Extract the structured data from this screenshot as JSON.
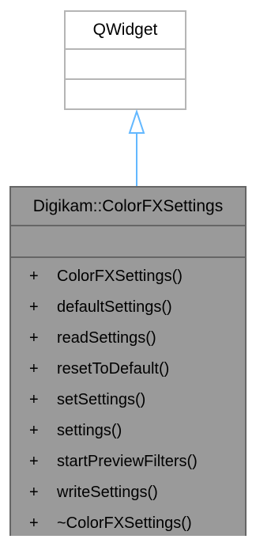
{
  "base_class": {
    "name": "QWidget"
  },
  "derived_class": {
    "name": "Digikam::ColorFXSettings",
    "methods": [
      {
        "visibility": "+",
        "name": "ColorFXSettings()"
      },
      {
        "visibility": "+",
        "name": "defaultSettings()"
      },
      {
        "visibility": "+",
        "name": "readSettings()"
      },
      {
        "visibility": "+",
        "name": "resetToDefault()"
      },
      {
        "visibility": "+",
        "name": "setSettings()"
      },
      {
        "visibility": "+",
        "name": "settings()"
      },
      {
        "visibility": "+",
        "name": "startPreviewFilters()"
      },
      {
        "visibility": "+",
        "name": "writeSettings()"
      },
      {
        "visibility": "+",
        "name": "~ColorFXSettings()"
      }
    ]
  },
  "colors": {
    "base_border": "#b5b5b5",
    "derived_fill": "#9a9a9a",
    "derived_border": "#666666",
    "arrow": "#63b8ff"
  }
}
